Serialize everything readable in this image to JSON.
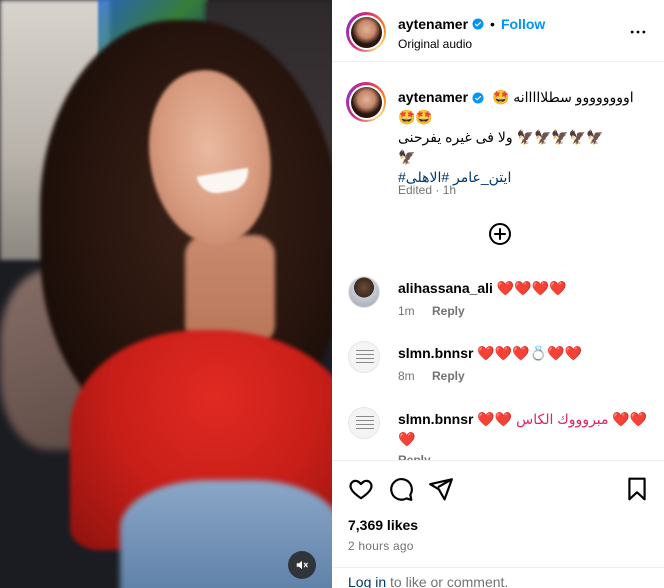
{
  "post": {
    "username": "aytenamer",
    "follow_label": "Follow",
    "separator": "•",
    "audio_label": "Original audio"
  },
  "caption": {
    "username": "aytenamer",
    "line1": "🤩 اوووووووو سطلااااانه",
    "line2": "🤩🤩",
    "line3": "ولا فى غيره يفرحنى 🦅🦅🦅🦅🦅",
    "line4": "🦅",
    "hashtags": "#ايتن_عامر #الاهلى",
    "edited": "Edited · 1h"
  },
  "comments": [
    {
      "username": "alihassana_ali",
      "text": "❤️❤️❤️❤️",
      "time": "1m",
      "reply": "Reply",
      "avatar": "man-avatar"
    },
    {
      "username": "slmn.bnnsr",
      "text": "❤️❤️❤️💍❤️❤️",
      "time": "8m",
      "reply": "Reply",
      "avatar": "note-avatar"
    },
    {
      "username": "slmn.bnnsr",
      "text": "❤️❤️ مبروووك الكاس ❤️❤️",
      "text2": "❤️",
      "time": "",
      "reply": "Reply",
      "avatar": "note-avatar"
    }
  ],
  "actions": {
    "likes": "7,369 likes",
    "time_ago": "2 hours ago"
  },
  "login": {
    "link": "Log in",
    "rest": " to like or comment."
  },
  "icons": {
    "verified": "verified-badge-icon",
    "more": "more-options-icon",
    "load_more": "plus-circle-icon",
    "mute": "muted-speaker-icon",
    "like": "heart-outline-icon",
    "comment": "comment-bubble-icon",
    "share": "paper-plane-icon",
    "save": "bookmark-icon"
  },
  "colors": {
    "accent": "#0095f6",
    "hashtag": "#00376b",
    "muted": "#737373"
  }
}
